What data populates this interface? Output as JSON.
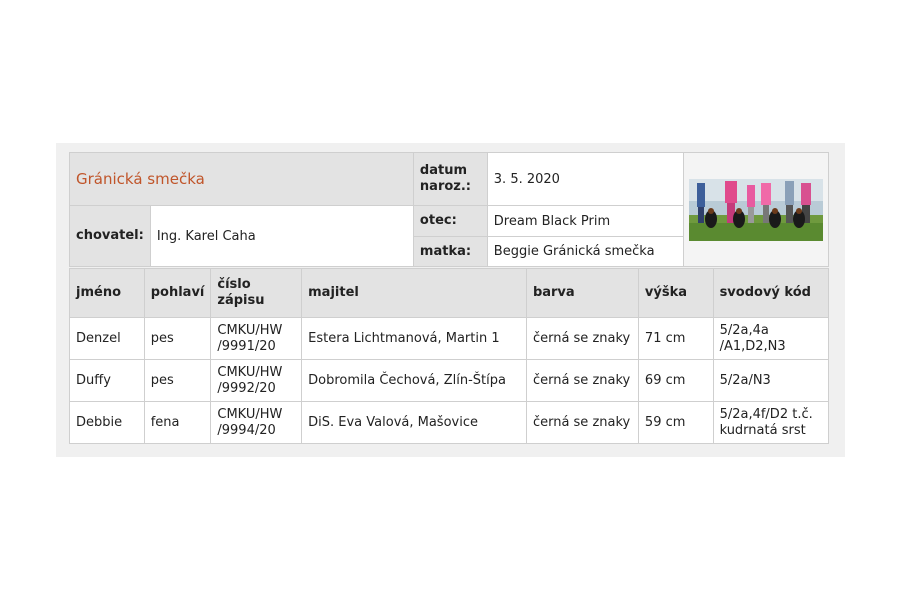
{
  "litter": {
    "title": "Gránická smečka",
    "birth_label": "datum naroz.:",
    "birth_value": "3. 5. 2020",
    "breeder_label": "chovatel:",
    "breeder_value": "Ing. Karel Caha",
    "sire_label": "otec:",
    "sire_value": "Dream Black Prim",
    "dam_label": "matka:",
    "dam_value": "Beggie Gránická smečka"
  },
  "table": {
    "headers": [
      "jméno",
      "pohlaví",
      "číslo zápisu",
      "majitel",
      "barva",
      "výška",
      "svodový kód"
    ],
    "rows": [
      [
        "Denzel",
        "pes",
        "CMKU/HW /9991/20",
        "Estera Lichtmanová, Martin 1",
        "černá se znaky",
        "71 cm",
        "5/2a,4a /A1,D2,N3"
      ],
      [
        "Duffy",
        "pes",
        "CMKU/HW /9992/20",
        "Dobromila Čechová, Zlín-Štípa",
        "černá se znaky",
        "69 cm",
        "5/2a/N3"
      ],
      [
        "Debbie",
        "fena",
        "CMKU/HW /9994/20",
        "DiS. Eva Valová, Mašovice",
        "černá se znaky",
        "59 cm",
        "5/2a,4f/D2 t.č. kudrnatá srst"
      ]
    ]
  },
  "colors": {
    "title": "#c0552a",
    "header_bg": "#e3e3e3",
    "panel_bg": "#f0f0f0",
    "border": "#cfcfcf"
  }
}
